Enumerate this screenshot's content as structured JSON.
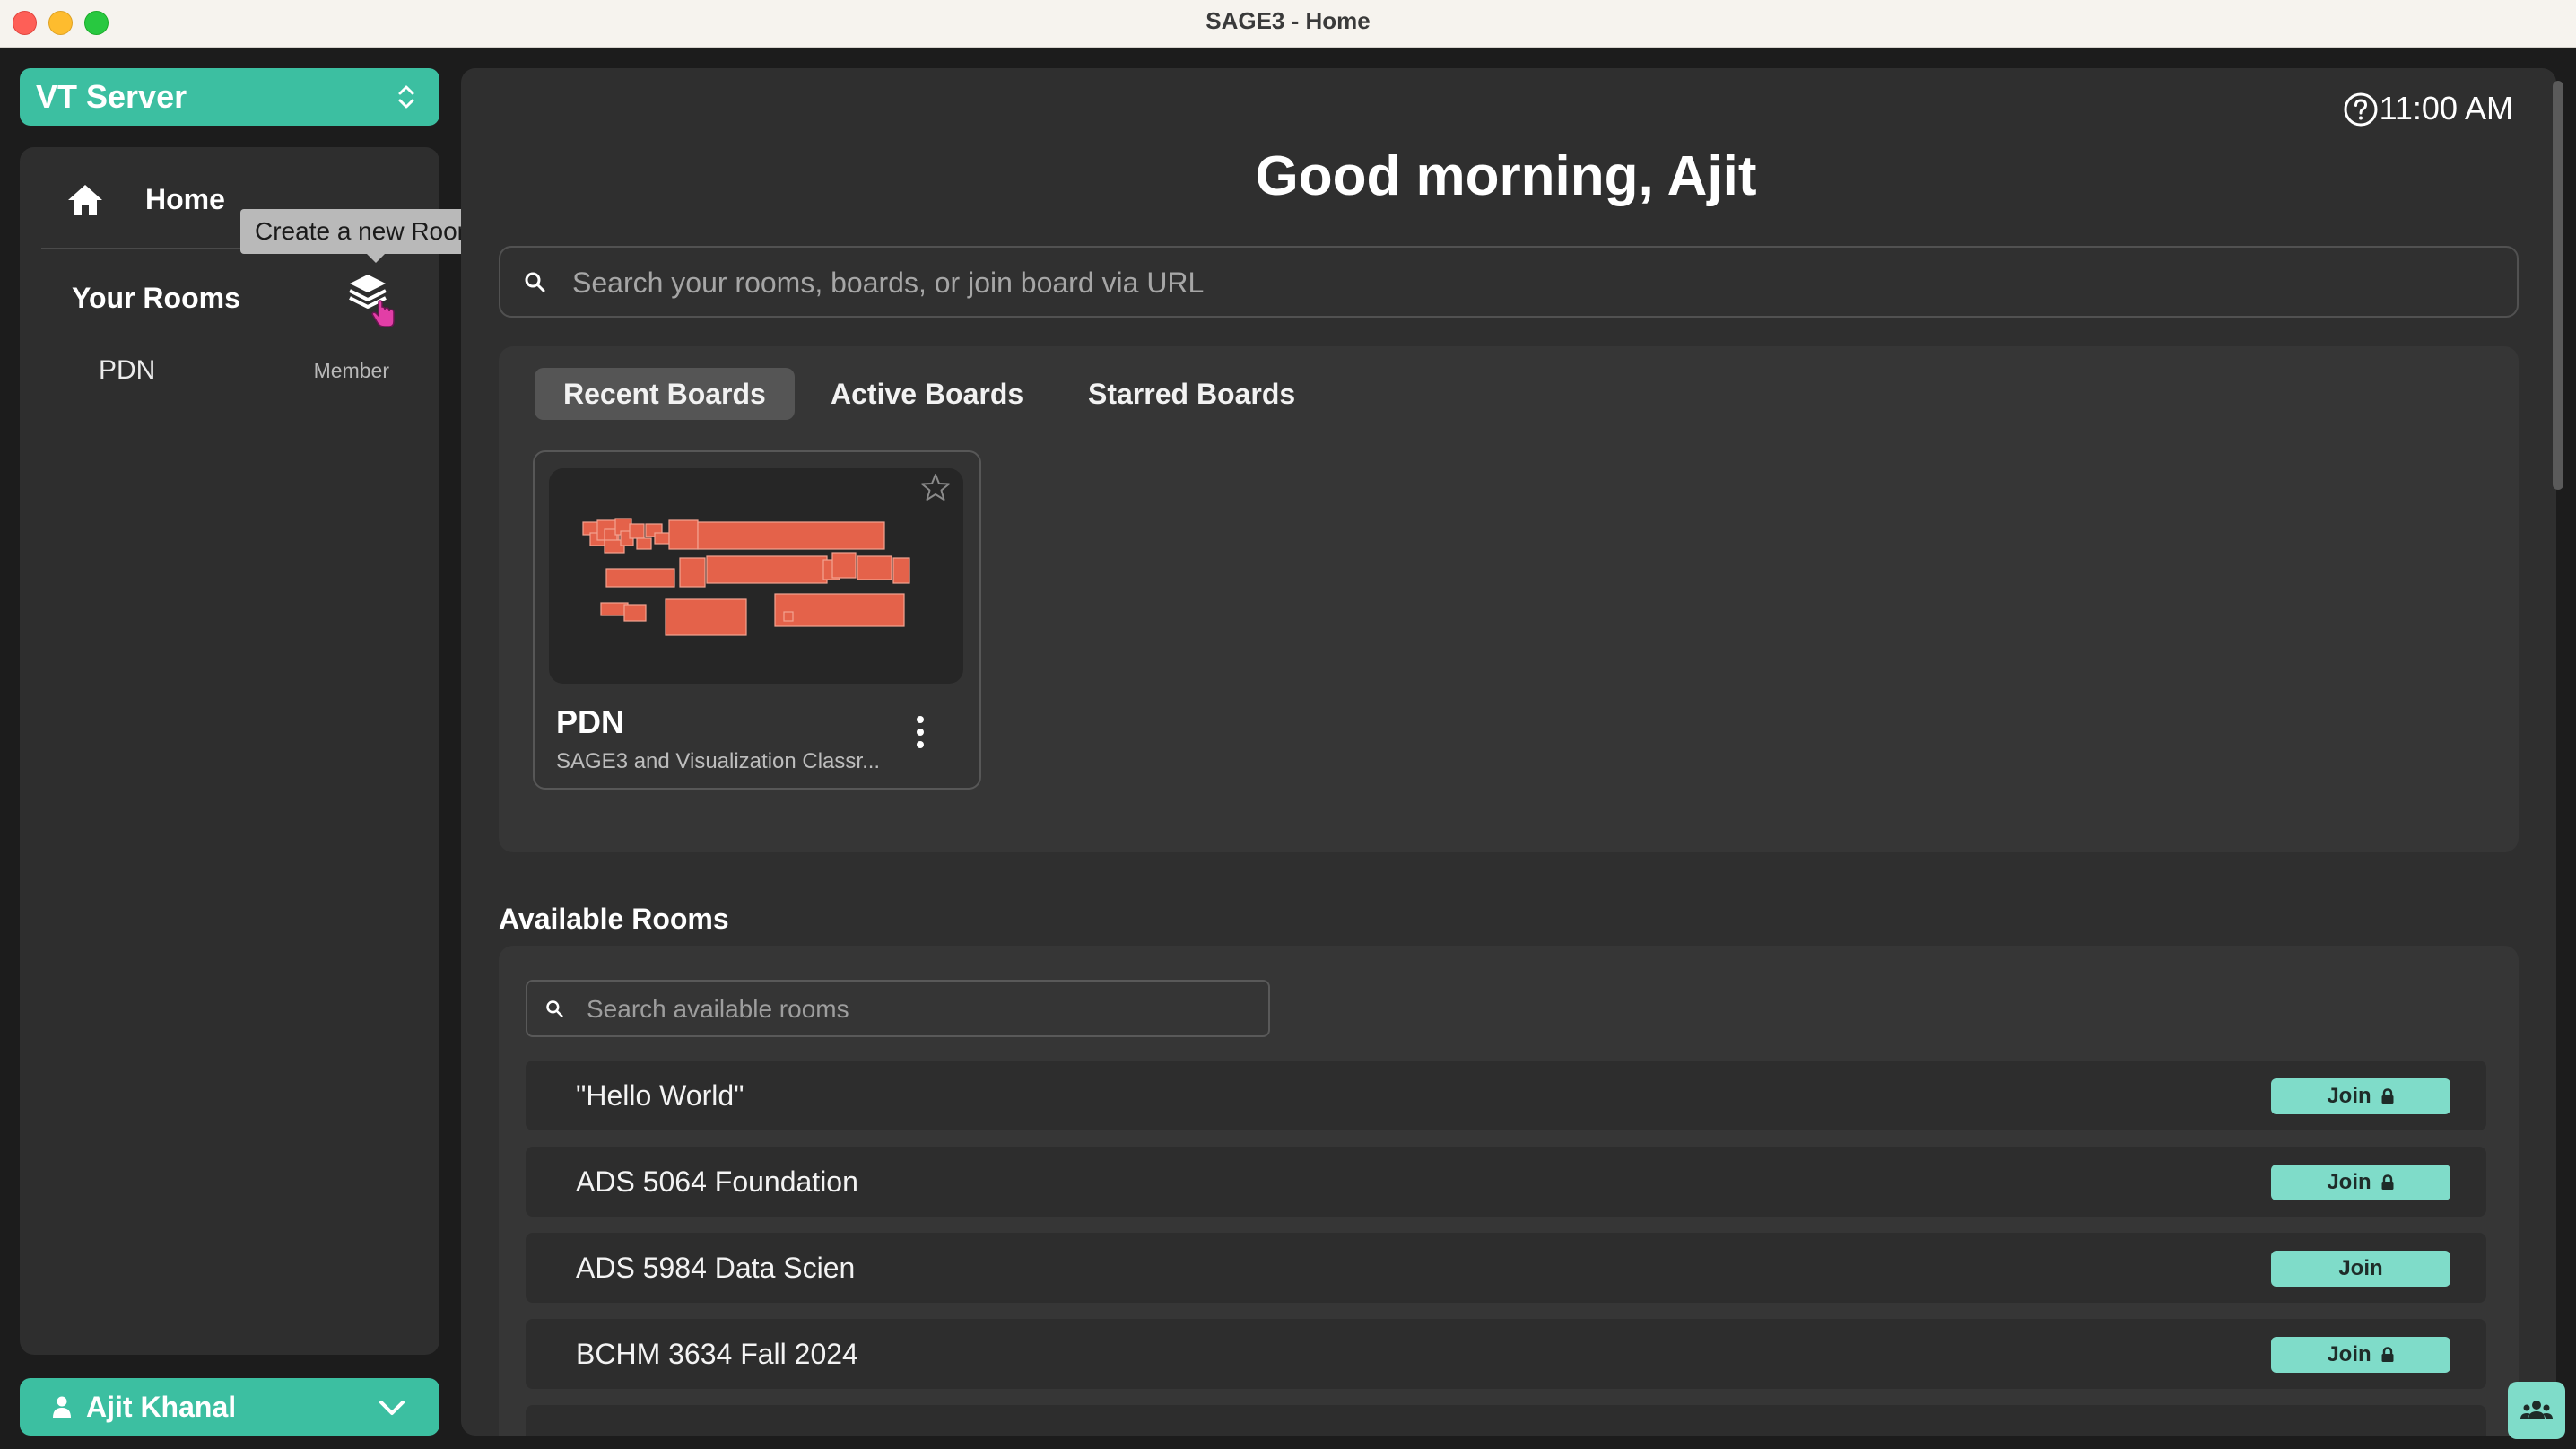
{
  "window": {
    "title": "SAGE3 - Home"
  },
  "server": {
    "name": "VT Server"
  },
  "sidebar": {
    "home_label": "Home",
    "your_rooms_label": "Your Rooms",
    "tooltip": "Create a new Room",
    "rooms": [
      {
        "name": "PDN",
        "role": "Member"
      }
    ]
  },
  "user": {
    "name": "Ajit Khanal"
  },
  "header": {
    "time": "11:00 AM",
    "greeting": "Good morning, Ajit"
  },
  "search": {
    "placeholder": "Search your rooms, boards, or join board via URL"
  },
  "board_tabs": [
    "Recent Boards",
    "Active Boards",
    "Starred Boards"
  ],
  "active_tab": "Recent Boards",
  "boards": [
    {
      "name": "PDN",
      "description": "SAGE3 and Visualization Classr..."
    }
  ],
  "available_rooms": {
    "title": "Available Rooms",
    "search_placeholder": "Search available rooms",
    "join_label": "Join",
    "rooms": [
      {
        "name": "\"Hello World\"",
        "locked": true
      },
      {
        "name": "ADS 5064 Foundation",
        "locked": true
      },
      {
        "name": "ADS 5984 Data Scien",
        "locked": false
      },
      {
        "name": "BCHM 3634 Fall 2024",
        "locked": true
      }
    ]
  },
  "colors": {
    "accent": "#3cbfa1",
    "join": "#7fdcc9",
    "board_thumb": "#e4624a"
  }
}
